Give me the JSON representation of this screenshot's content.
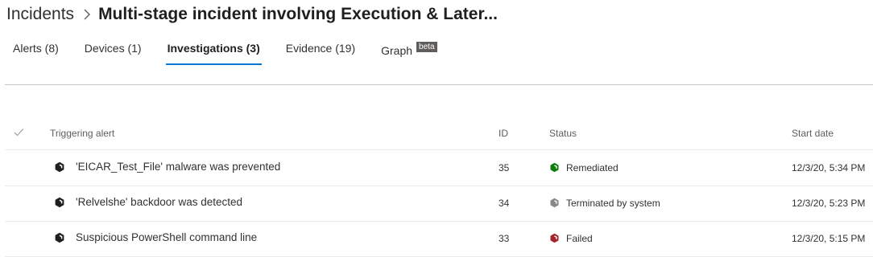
{
  "breadcrumb": {
    "root": "Incidents",
    "title": "Multi-stage incident involving Execution & Later..."
  },
  "tabs": [
    {
      "label": "Alerts (8)"
    },
    {
      "label": "Devices (1)"
    },
    {
      "label": "Investigations (3)",
      "active": true
    },
    {
      "label": "Evidence (19)"
    },
    {
      "label": "Graph",
      "badge": "beta"
    }
  ],
  "table": {
    "columns": {
      "alert": "Triggering alert",
      "id": "ID",
      "status": "Status",
      "start": "Start date"
    },
    "rows": [
      {
        "alert": "'EICAR_Test_File' malware was prevented",
        "id": "35",
        "status": "Remediated",
        "status_color": "#107c10",
        "start": "12/3/20, 5:34 PM"
      },
      {
        "alert": "'Relvelshe' backdoor was detected",
        "id": "34",
        "status": "Terminated by system",
        "status_color": "#8a8886",
        "start": "12/3/20, 5:23 PM"
      },
      {
        "alert": "Suspicious PowerShell command line",
        "id": "33",
        "status": "Failed",
        "status_color": "#a4262c",
        "start": "12/3/20, 5:15 PM"
      }
    ]
  },
  "icons": {
    "alert": "investigation-hexagon-icon",
    "status": "status-hexagon-icon",
    "separator": "chevron-right-icon",
    "select_all": "checkmark-icon"
  }
}
